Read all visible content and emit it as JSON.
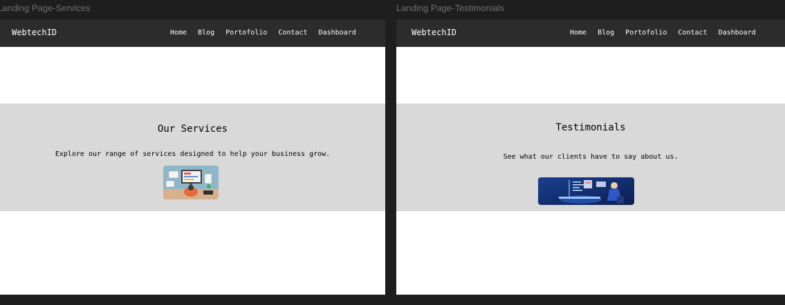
{
  "colors": {
    "canvas_bg": "#1e1e1e",
    "navbar_bg": "#2c2c2c",
    "section_bg": "#d9d9d9",
    "frame_bg": "#ffffff",
    "frame_label": "#6f6f6f"
  },
  "frames": [
    {
      "label": "Landing Page-Services",
      "navbar": {
        "brand": "WebtechID",
        "links": [
          "Home",
          "Blog",
          "Portofolio",
          "Contact",
          "Dashboard"
        ]
      },
      "section": {
        "title": "Our Services",
        "description": "Explore our range of services designed to help your business grow.",
        "image_icon": "workspace-illustration"
      }
    },
    {
      "label": "Landing Page-Testimonials",
      "navbar": {
        "brand": "WebtechID",
        "links": [
          "Home",
          "Blog",
          "Portofolio",
          "Contact",
          "Dashboard"
        ]
      },
      "section": {
        "title": "Testimonials",
        "description": "See what our clients have to say about us.",
        "image_icon": "developer-illustration"
      }
    }
  ]
}
